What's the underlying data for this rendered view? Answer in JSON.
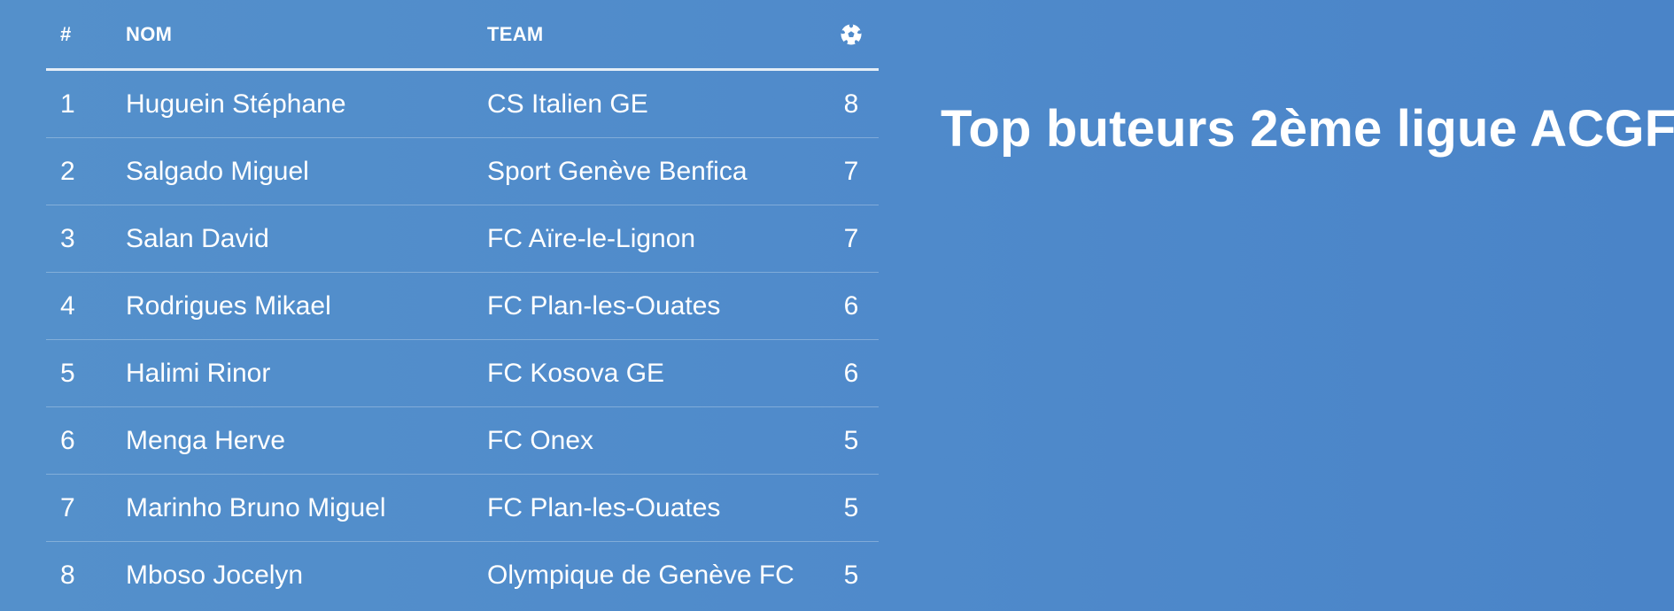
{
  "title": "Top buteurs 2ème ligue ACGF",
  "table": {
    "headers": {
      "rank": "#",
      "name": "NOM",
      "team": "TEAM",
      "goals_icon": "soccer-ball-icon"
    },
    "rows": [
      {
        "rank": "1",
        "name": "Huguein Stéphane",
        "team": "CS Italien GE",
        "goals": "8"
      },
      {
        "rank": "2",
        "name": "Salgado Miguel",
        "team": "Sport Genève Benfica",
        "goals": "7"
      },
      {
        "rank": "3",
        "name": "Salan David",
        "team": "FC Aïre-le-Lignon",
        "goals": "7"
      },
      {
        "rank": "4",
        "name": "Rodrigues Mikael",
        "team": "FC Plan-les-Ouates",
        "goals": "6"
      },
      {
        "rank": "5",
        "name": "Halimi Rinor",
        "team": "FC Kosova GE",
        "goals": "6"
      },
      {
        "rank": "6",
        "name": "Menga Herve",
        "team": "FC Onex",
        "goals": "5"
      },
      {
        "rank": "7",
        "name": "Marinho Bruno Miguel",
        "team": "FC Plan-les-Ouates",
        "goals": "5"
      },
      {
        "rank": "8",
        "name": "Mboso Jocelyn",
        "team": "Olympique de Genève FC",
        "goals": "5"
      }
    ]
  },
  "colors": {
    "background": "#4f8acb",
    "text": "#ffffff"
  }
}
